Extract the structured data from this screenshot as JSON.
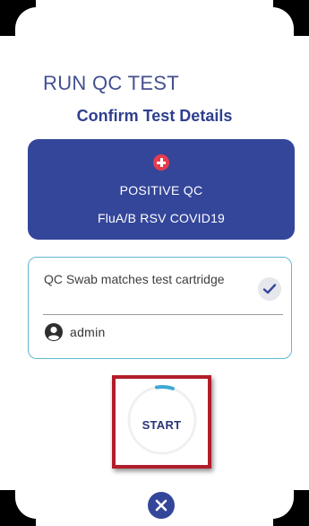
{
  "screen": {
    "title": "RUN QC TEST",
    "subtitle": "Confirm Test Details"
  },
  "qc_card": {
    "icon": "plus-circle-icon",
    "type_label": "POSITIVE QC",
    "panel_label": "FluA/B RSV COVID19",
    "background_color": "#34469a",
    "icon_color": "#e83b4d"
  },
  "details": {
    "swab_text": "QC Swab matches test cartridge",
    "swab_status_icon": "checkmark-icon",
    "user_icon": "user-circle-icon",
    "user_name": "admin",
    "border_color": "#62b9d1"
  },
  "actions": {
    "start_label": "START",
    "close_icon": "close-icon",
    "highlight_color": "#b11d2a"
  }
}
